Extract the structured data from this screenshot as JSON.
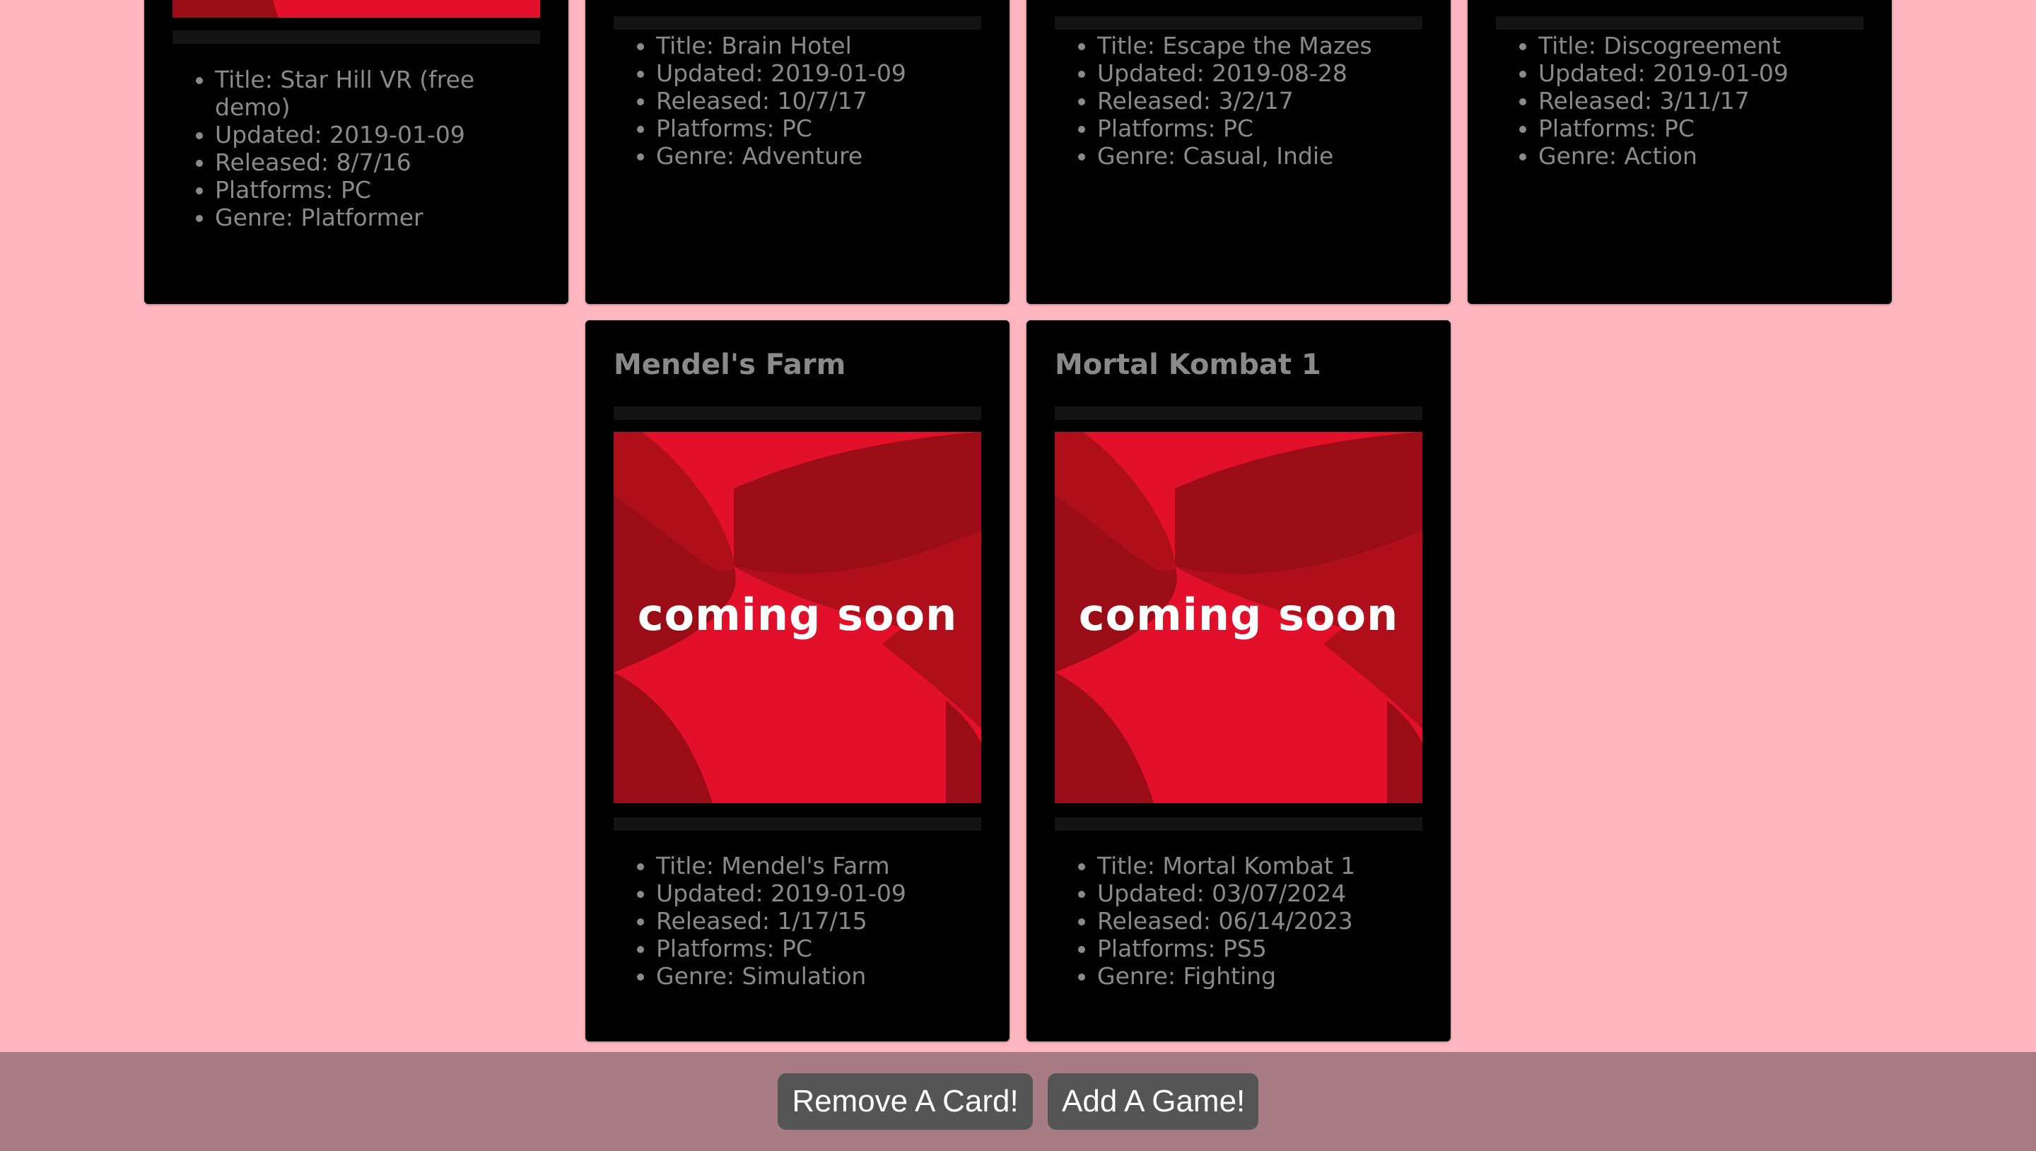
{
  "cards": [
    {
      "image_alt": "coming soon",
      "details": [
        "Title: Star Hill VR (free demo)",
        "Updated: 2019-01-09",
        "Released: 8/7/16",
        "Platforms: PC",
        "Genre: Platformer"
      ]
    },
    {
      "details": [
        "Title: Brain Hotel",
        "Updated: 2019-01-09",
        "Released: 10/7/17",
        "Platforms: PC",
        "Genre: Adventure"
      ]
    },
    {
      "details": [
        "Title: Escape the Mazes",
        "Updated: 2019-08-28",
        "Released: 3/2/17",
        "Platforms: PC",
        "Genre: Casual, Indie"
      ]
    },
    {
      "details": [
        "Title: Discogreement",
        "Updated: 2019-01-09",
        "Released: 3/11/17",
        "Platforms: PC",
        "Genre: Action"
      ]
    },
    {
      "title": "Mendel's Farm",
      "image_text": "coming soon",
      "details": [
        "Title: Mendel's Farm",
        "Updated: 2019-01-09",
        "Released: 1/17/15",
        "Platforms: PC",
        "Genre: Simulation"
      ]
    },
    {
      "title": "Mortal Kombat 1",
      "image_text": "coming soon",
      "details": [
        "Title: Mortal Kombat 1",
        "Updated: 03/07/2024",
        "Released: 06/14/2023",
        "Platforms: PS5",
        "Genre: Fighting"
      ]
    }
  ],
  "footer": {
    "remove_label": "Remove A Card!",
    "add_label": "Add A Game!"
  },
  "colors": {
    "page_background": "#ffb6c1",
    "card_background": "#000000",
    "footer_background": "#a87c84",
    "button_background": "#555555",
    "image_red": "#e3102b"
  }
}
